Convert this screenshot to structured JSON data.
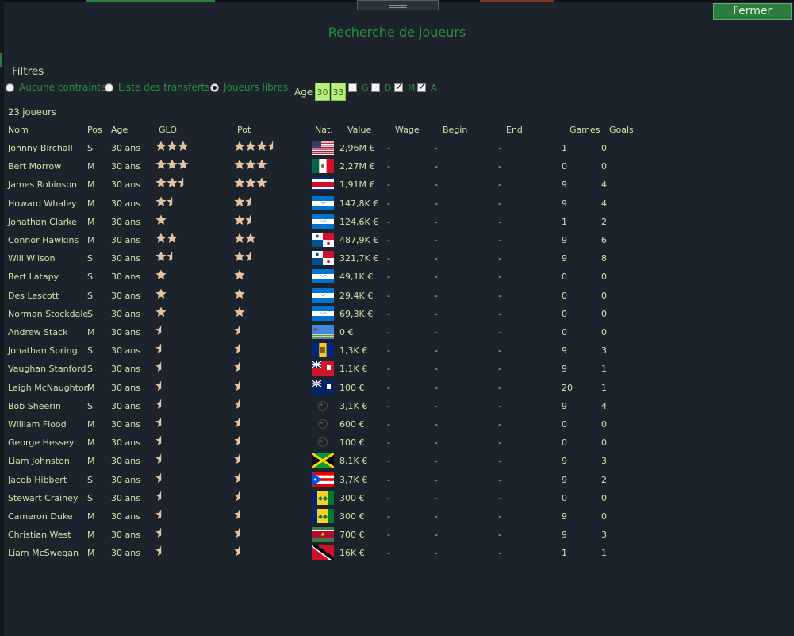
{
  "window": {
    "title": "Recherche de joueurs",
    "close_label": "Fermer"
  },
  "filters": {
    "label": "Filtres",
    "options": [
      {
        "label": "Aucune contrainte",
        "selected": false
      },
      {
        "label": "Liste des transferts",
        "selected": false
      },
      {
        "label": "Joueurs libres",
        "selected": true
      }
    ],
    "age_label": "Age",
    "age_min": "30",
    "age_max": "33",
    "positions": [
      {
        "label": "G",
        "checked": false
      },
      {
        "label": "D",
        "checked": false
      },
      {
        "label": "M",
        "checked": true
      },
      {
        "label": "A",
        "checked": true
      }
    ]
  },
  "results": {
    "count_label": "23 joueurs",
    "columns": [
      "Nom",
      "Pos",
      "Age",
      "GLO",
      "Pot",
      "Nat.",
      "Value",
      "Wage",
      "Begin",
      "End",
      "Games",
      "Goals"
    ],
    "rows": [
      {
        "name": "Johnny Birchall",
        "pos": "S",
        "age": "30 ans",
        "glo": 3,
        "pot": 3.5,
        "flag": "usa",
        "value": "2,96M €",
        "wage": "-",
        "begin": "-",
        "end": "-",
        "games": "1",
        "goals": "0"
      },
      {
        "name": "Bert Morrow",
        "pos": "M",
        "age": "30 ans",
        "glo": 3,
        "pot": 3,
        "flag": "mexico",
        "value": "2,27M €",
        "wage": "-",
        "begin": "-",
        "end": "-",
        "games": "0",
        "goals": "0"
      },
      {
        "name": "James Robinson",
        "pos": "M",
        "age": "30 ans",
        "glo": 2.5,
        "pot": 3,
        "flag": "costa-rica",
        "value": "1,91M €",
        "wage": "-",
        "begin": "-",
        "end": "-",
        "games": "9",
        "goals": "4"
      },
      {
        "name": "Howard Whaley",
        "pos": "M",
        "age": "30 ans",
        "glo": 1.5,
        "pot": 1.5,
        "flag": "honduras",
        "value": "147,8K €",
        "wage": "-",
        "begin": "-",
        "end": "-",
        "games": "9",
        "goals": "4"
      },
      {
        "name": "Jonathan Clarke",
        "pos": "M",
        "age": "30 ans",
        "glo": 1,
        "pot": 1.5,
        "flag": "honduras",
        "value": "124,6K €",
        "wage": "-",
        "begin": "-",
        "end": "-",
        "games": "1",
        "goals": "2"
      },
      {
        "name": "Connor Hawkins",
        "pos": "M",
        "age": "30 ans",
        "glo": 2,
        "pot": 2,
        "flag": "panama",
        "value": "487,9K €",
        "wage": "-",
        "begin": "-",
        "end": "-",
        "games": "9",
        "goals": "6"
      },
      {
        "name": "Will Wilson",
        "pos": "S",
        "age": "30 ans",
        "glo": 1.5,
        "pot": 1.5,
        "flag": "panama",
        "value": "321,7K €",
        "wage": "-",
        "begin": "-",
        "end": "-",
        "games": "9",
        "goals": "8"
      },
      {
        "name": "Bert Latapy",
        "pos": "S",
        "age": "30 ans",
        "glo": 1,
        "pot": 1,
        "flag": "honduras",
        "value": "49,1K €",
        "wage": "-",
        "begin": "-",
        "end": "-",
        "games": "0",
        "goals": "0"
      },
      {
        "name": "Des Lescott",
        "pos": "S",
        "age": "30 ans",
        "glo": 1,
        "pot": 1,
        "flag": "honduras",
        "value": "29,4K €",
        "wage": "-",
        "begin": "-",
        "end": "-",
        "games": "0",
        "goals": "0"
      },
      {
        "name": "Norman Stockdale",
        "pos": "S",
        "age": "30 ans",
        "glo": 1,
        "pot": 1,
        "flag": "honduras",
        "value": "69,3K €",
        "wage": "-",
        "begin": "-",
        "end": "-",
        "games": "0",
        "goals": "0"
      },
      {
        "name": "Andrew Stack",
        "pos": "M",
        "age": "30 ans",
        "glo": 0.5,
        "pot": 0.5,
        "flag": "aruba",
        "value": "0 €",
        "wage": "-",
        "begin": "-",
        "end": "-",
        "games": "0",
        "goals": "0"
      },
      {
        "name": "Jonathan Spring",
        "pos": "S",
        "age": "30 ans",
        "glo": 0.5,
        "pot": 0.5,
        "flag": "barbados",
        "value": "1,3K €",
        "wage": "-",
        "begin": "-",
        "end": "-",
        "games": "9",
        "goals": "3"
      },
      {
        "name": "Vaughan Stanford",
        "pos": "S",
        "age": "30 ans",
        "glo": 0.5,
        "pot": 0.5,
        "flag": "bermuda",
        "value": "1,1K €",
        "wage": "-",
        "begin": "-",
        "end": "-",
        "games": "9",
        "goals": "1"
      },
      {
        "name": "Leigh McNaughton",
        "pos": "M",
        "age": "30 ans",
        "glo": 0.5,
        "pot": 0.5,
        "flag": "cayman",
        "value": "100 €",
        "wage": "-",
        "begin": "-",
        "end": "-",
        "games": "20",
        "goals": "1"
      },
      {
        "name": "Bob Sheerin",
        "pos": "S",
        "age": "30 ans",
        "glo": 0.5,
        "pot": 0.5,
        "flag": "ball",
        "value": "3,1K €",
        "wage": "-",
        "begin": "-",
        "end": "-",
        "games": "9",
        "goals": "4"
      },
      {
        "name": "William Flood",
        "pos": "M",
        "age": "30 ans",
        "glo": 0.5,
        "pot": 0.5,
        "flag": "ball",
        "value": "600 €",
        "wage": "-",
        "begin": "-",
        "end": "-",
        "games": "0",
        "goals": "0"
      },
      {
        "name": "George Hessey",
        "pos": "M",
        "age": "30 ans",
        "glo": 0.5,
        "pot": 0.5,
        "flag": "ball",
        "value": "100 €",
        "wage": "-",
        "begin": "-",
        "end": "-",
        "games": "0",
        "goals": "0"
      },
      {
        "name": "Liam Johnston",
        "pos": "M",
        "age": "30 ans",
        "glo": 0.5,
        "pot": 0.5,
        "flag": "jamaica",
        "value": "8,1K €",
        "wage": "-",
        "begin": "-",
        "end": "-",
        "games": "9",
        "goals": "3"
      },
      {
        "name": "Jacob Hibbert",
        "pos": "S",
        "age": "30 ans",
        "glo": 0.5,
        "pot": 0.5,
        "flag": "puerto-rico",
        "value": "3,7K €",
        "wage": "-",
        "begin": "-",
        "end": "-",
        "games": "9",
        "goals": "2"
      },
      {
        "name": "Stewart Crainey",
        "pos": "S",
        "age": "30 ans",
        "glo": 0.5,
        "pot": 0.5,
        "flag": "st-vincent",
        "value": "300 €",
        "wage": "-",
        "begin": "-",
        "end": "-",
        "games": "0",
        "goals": "0"
      },
      {
        "name": "Cameron Duke",
        "pos": "M",
        "age": "30 ans",
        "glo": 0.5,
        "pot": 0.5,
        "flag": "st-vincent",
        "value": "300 €",
        "wage": "-",
        "begin": "-",
        "end": "-",
        "games": "9",
        "goals": "0"
      },
      {
        "name": "Christian West",
        "pos": "M",
        "age": "30 ans",
        "glo": 0.5,
        "pot": 0.5,
        "flag": "suriname",
        "value": "700 €",
        "wage": "-",
        "begin": "-",
        "end": "-",
        "games": "9",
        "goals": "3"
      },
      {
        "name": "Liam McSwegan",
        "pos": "M",
        "age": "30 ans",
        "glo": 0.5,
        "pot": 0.5,
        "flag": "trinidad",
        "value": "16K €",
        "wage": "-",
        "begin": "-",
        "end": "-",
        "games": "1",
        "goals": "1"
      }
    ]
  }
}
